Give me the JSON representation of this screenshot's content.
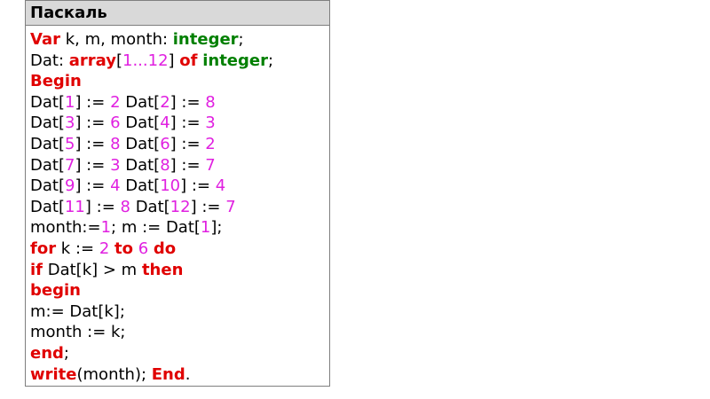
{
  "header": {
    "title": "Паскаль"
  },
  "colors": {
    "keyword": "#e00000",
    "type": "#008000",
    "number": "#e020e0",
    "plain": "#000000",
    "header_bg": "#d9d9d9",
    "border": "#7f7f7f"
  },
  "code": {
    "lines": [
      [
        {
          "t": "Var",
          "c": "kw"
        },
        {
          "t": " k, m, month: ",
          "c": "plain"
        },
        {
          "t": "integer",
          "c": "type"
        },
        {
          "t": ";",
          "c": "plain"
        }
      ],
      [
        {
          "t": "Dat: ",
          "c": "plain"
        },
        {
          "t": "array",
          "c": "kw"
        },
        {
          "t": "[",
          "c": "plain"
        },
        {
          "t": "1...12",
          "c": "num"
        },
        {
          "t": "] ",
          "c": "plain"
        },
        {
          "t": "of",
          "c": "kw"
        },
        {
          "t": " ",
          "c": "plain"
        },
        {
          "t": "integer",
          "c": "type"
        },
        {
          "t": ";",
          "c": "plain"
        }
      ],
      [
        {
          "t": "Begin",
          "c": "kw"
        }
      ],
      [
        {
          "t": "Dat[",
          "c": "plain"
        },
        {
          "t": "1",
          "c": "num"
        },
        {
          "t": "] := ",
          "c": "plain"
        },
        {
          "t": "2",
          "c": "num"
        },
        {
          "t": " Dat[",
          "c": "plain"
        },
        {
          "t": "2",
          "c": "num"
        },
        {
          "t": "] := ",
          "c": "plain"
        },
        {
          "t": "8",
          "c": "num"
        }
      ],
      [
        {
          "t": "Dat[",
          "c": "plain"
        },
        {
          "t": "3",
          "c": "num"
        },
        {
          "t": "] := ",
          "c": "plain"
        },
        {
          "t": "6",
          "c": "num"
        },
        {
          "t": " Dat[",
          "c": "plain"
        },
        {
          "t": "4",
          "c": "num"
        },
        {
          "t": "] := ",
          "c": "plain"
        },
        {
          "t": "3",
          "c": "num"
        }
      ],
      [
        {
          "t": "Dat[",
          "c": "plain"
        },
        {
          "t": "5",
          "c": "num"
        },
        {
          "t": "] := ",
          "c": "plain"
        },
        {
          "t": "8",
          "c": "num"
        },
        {
          "t": " Dat[",
          "c": "plain"
        },
        {
          "t": "6",
          "c": "num"
        },
        {
          "t": "] := ",
          "c": "plain"
        },
        {
          "t": "2",
          "c": "num"
        }
      ],
      [
        {
          "t": "Dat[",
          "c": "plain"
        },
        {
          "t": "7",
          "c": "num"
        },
        {
          "t": "] := ",
          "c": "plain"
        },
        {
          "t": "3",
          "c": "num"
        },
        {
          "t": " Dat[",
          "c": "plain"
        },
        {
          "t": "8",
          "c": "num"
        },
        {
          "t": "] := ",
          "c": "plain"
        },
        {
          "t": "7",
          "c": "num"
        }
      ],
      [
        {
          "t": "Dat[",
          "c": "plain"
        },
        {
          "t": "9",
          "c": "num"
        },
        {
          "t": "] := ",
          "c": "plain"
        },
        {
          "t": "4",
          "c": "num"
        },
        {
          "t": " Dat[",
          "c": "plain"
        },
        {
          "t": "10",
          "c": "num"
        },
        {
          "t": "] := ",
          "c": "plain"
        },
        {
          "t": "4",
          "c": "num"
        }
      ],
      [
        {
          "t": "Dat[",
          "c": "plain"
        },
        {
          "t": "11",
          "c": "num"
        },
        {
          "t": "] := ",
          "c": "plain"
        },
        {
          "t": "8",
          "c": "num"
        },
        {
          "t": " Dat[",
          "c": "plain"
        },
        {
          "t": "12",
          "c": "num"
        },
        {
          "t": "] := ",
          "c": "plain"
        },
        {
          "t": "7",
          "c": "num"
        }
      ],
      [
        {
          "t": "month:=",
          "c": "plain"
        },
        {
          "t": "1",
          "c": "num"
        },
        {
          "t": "; m := Dat[",
          "c": "plain"
        },
        {
          "t": "1",
          "c": "num"
        },
        {
          "t": "];",
          "c": "plain"
        }
      ],
      [
        {
          "t": "for",
          "c": "kw"
        },
        {
          "t": " k := ",
          "c": "plain"
        },
        {
          "t": "2",
          "c": "num"
        },
        {
          "t": " ",
          "c": "plain"
        },
        {
          "t": "to",
          "c": "kw"
        },
        {
          "t": " ",
          "c": "plain"
        },
        {
          "t": "6",
          "c": "num"
        },
        {
          "t": " ",
          "c": "plain"
        },
        {
          "t": "do",
          "c": "kw"
        }
      ],
      [
        {
          "t": "if",
          "c": "kw"
        },
        {
          "t": " Dat[k] > m ",
          "c": "plain"
        },
        {
          "t": "then",
          "c": "kw"
        }
      ],
      [
        {
          "t": "begin",
          "c": "kw"
        }
      ],
      [
        {
          "t": "m:= Dat[k];",
          "c": "plain"
        }
      ],
      [
        {
          "t": "month := k;",
          "c": "plain"
        }
      ],
      [
        {
          "t": "end",
          "c": "kw"
        },
        {
          "t": ";",
          "c": "plain"
        }
      ],
      [
        {
          "t": "write",
          "c": "kw"
        },
        {
          "t": "(month); ",
          "c": "plain"
        },
        {
          "t": "End",
          "c": "kw"
        },
        {
          "t": ".",
          "c": "plain"
        }
      ]
    ]
  }
}
